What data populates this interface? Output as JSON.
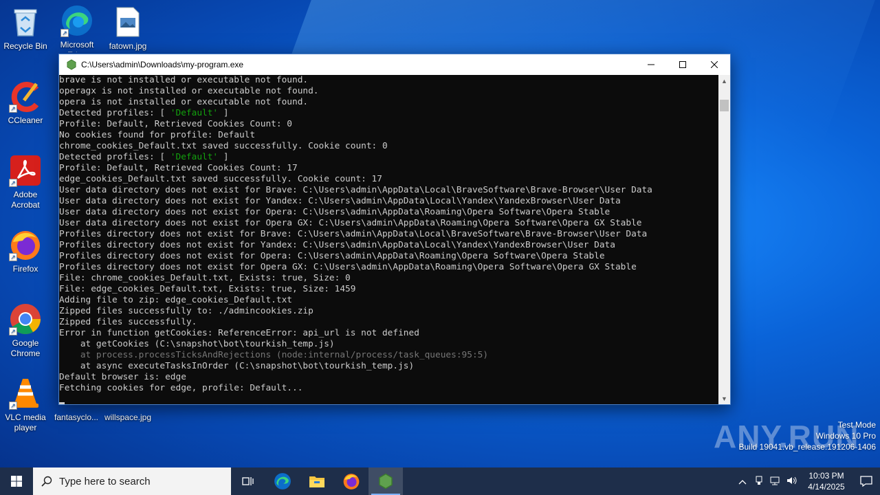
{
  "desktop": {
    "icons": [
      {
        "label": "Recycle Bin"
      },
      {
        "label": "Microsoft Edge"
      },
      {
        "label": "fatown.jpg"
      },
      {
        "label": "CCleaner"
      },
      {
        "label": "Adobe Acrobat"
      },
      {
        "label": "Firefox"
      },
      {
        "label": "Google Chrome"
      },
      {
        "label": "VLC media player"
      },
      {
        "label": "fantasyclo..."
      },
      {
        "label": "willspace.jpg"
      }
    ]
  },
  "window": {
    "title": "C:\\Users\\admin\\Downloads\\my-program.exe",
    "controls": {
      "minimize": "minimize",
      "maximize": "maximize",
      "close": "close"
    }
  },
  "console": {
    "lines": [
      {
        "text": "brave is not installed or executable not found."
      },
      {
        "text": "operagx is not installed or executable not found."
      },
      {
        "text": "opera is not installed or executable not found."
      },
      {
        "pre": "Detected profiles: [ ",
        "hl": "'Default'",
        "post": " ]"
      },
      {
        "text": "Profile: Default, Retrieved Cookies Count: 0"
      },
      {
        "text": "No cookies found for profile: Default"
      },
      {
        "text": "chrome_cookies_Default.txt saved successfully. Cookie count: 0"
      },
      {
        "pre": "Detected profiles: [ ",
        "hl": "'Default'",
        "post": " ]"
      },
      {
        "text": "Profile: Default, Retrieved Cookies Count: 17"
      },
      {
        "text": "edge_cookies_Default.txt saved successfully. Cookie count: 17"
      },
      {
        "text": "User data directory does not exist for Brave: C:\\Users\\admin\\AppData\\Local\\BraveSoftware\\Brave-Browser\\User Data"
      },
      {
        "text": "User data directory does not exist for Yandex: C:\\Users\\admin\\AppData\\Local\\Yandex\\YandexBrowser\\User Data"
      },
      {
        "text": "User data directory does not exist for Opera: C:\\Users\\admin\\AppData\\Roaming\\Opera Software\\Opera Stable"
      },
      {
        "text": "User data directory does not exist for Opera GX: C:\\Users\\admin\\AppData\\Roaming\\Opera Software\\Opera GX Stable"
      },
      {
        "text": "Profiles directory does not exist for Brave: C:\\Users\\admin\\AppData\\Local\\BraveSoftware\\Brave-Browser\\User Data"
      },
      {
        "text": "Profiles directory does not exist for Yandex: C:\\Users\\admin\\AppData\\Local\\Yandex\\YandexBrowser\\User Data"
      },
      {
        "text": "Profiles directory does not exist for Opera: C:\\Users\\admin\\AppData\\Roaming\\Opera Software\\Opera Stable"
      },
      {
        "text": "Profiles directory does not exist for Opera GX: C:\\Users\\admin\\AppData\\Roaming\\Opera Software\\Opera GX Stable"
      },
      {
        "text": "File: chrome_cookies_Default.txt, Exists: true, Size: 0"
      },
      {
        "text": "File: edge_cookies_Default.txt, Exists: true, Size: 1459"
      },
      {
        "text": "Adding file to zip: edge_cookies_Default.txt"
      },
      {
        "text": "Zipped files successfully to: ./admincookies.zip"
      },
      {
        "text": "Zipped files successfully."
      },
      {
        "text": "Error in function getCookies: ReferenceError: api_url is not defined"
      },
      {
        "text": "    at getCookies (C:\\snapshot\\bot\\tourkish_temp.js)"
      },
      {
        "text": "    at process.processTicksAndRejections (node:internal/process/task_queues:95:5)",
        "dim": true
      },
      {
        "text": "    at async executeTasksInOrder (C:\\snapshot\\bot\\tourkish_temp.js)"
      },
      {
        "text": "Default browser is: edge"
      },
      {
        "text": "Fetching cookies for edge, profile: Default..."
      }
    ]
  },
  "watermark": {
    "brand": "ANY.RUN",
    "line1": "Test Mode",
    "line2": "Windows 10 Pro",
    "line3": "Build 19041.vb_release.191206-1406"
  },
  "taskbar": {
    "search_placeholder": "Type here to search",
    "time": "10:03 PM",
    "date": "4/14/2025"
  }
}
